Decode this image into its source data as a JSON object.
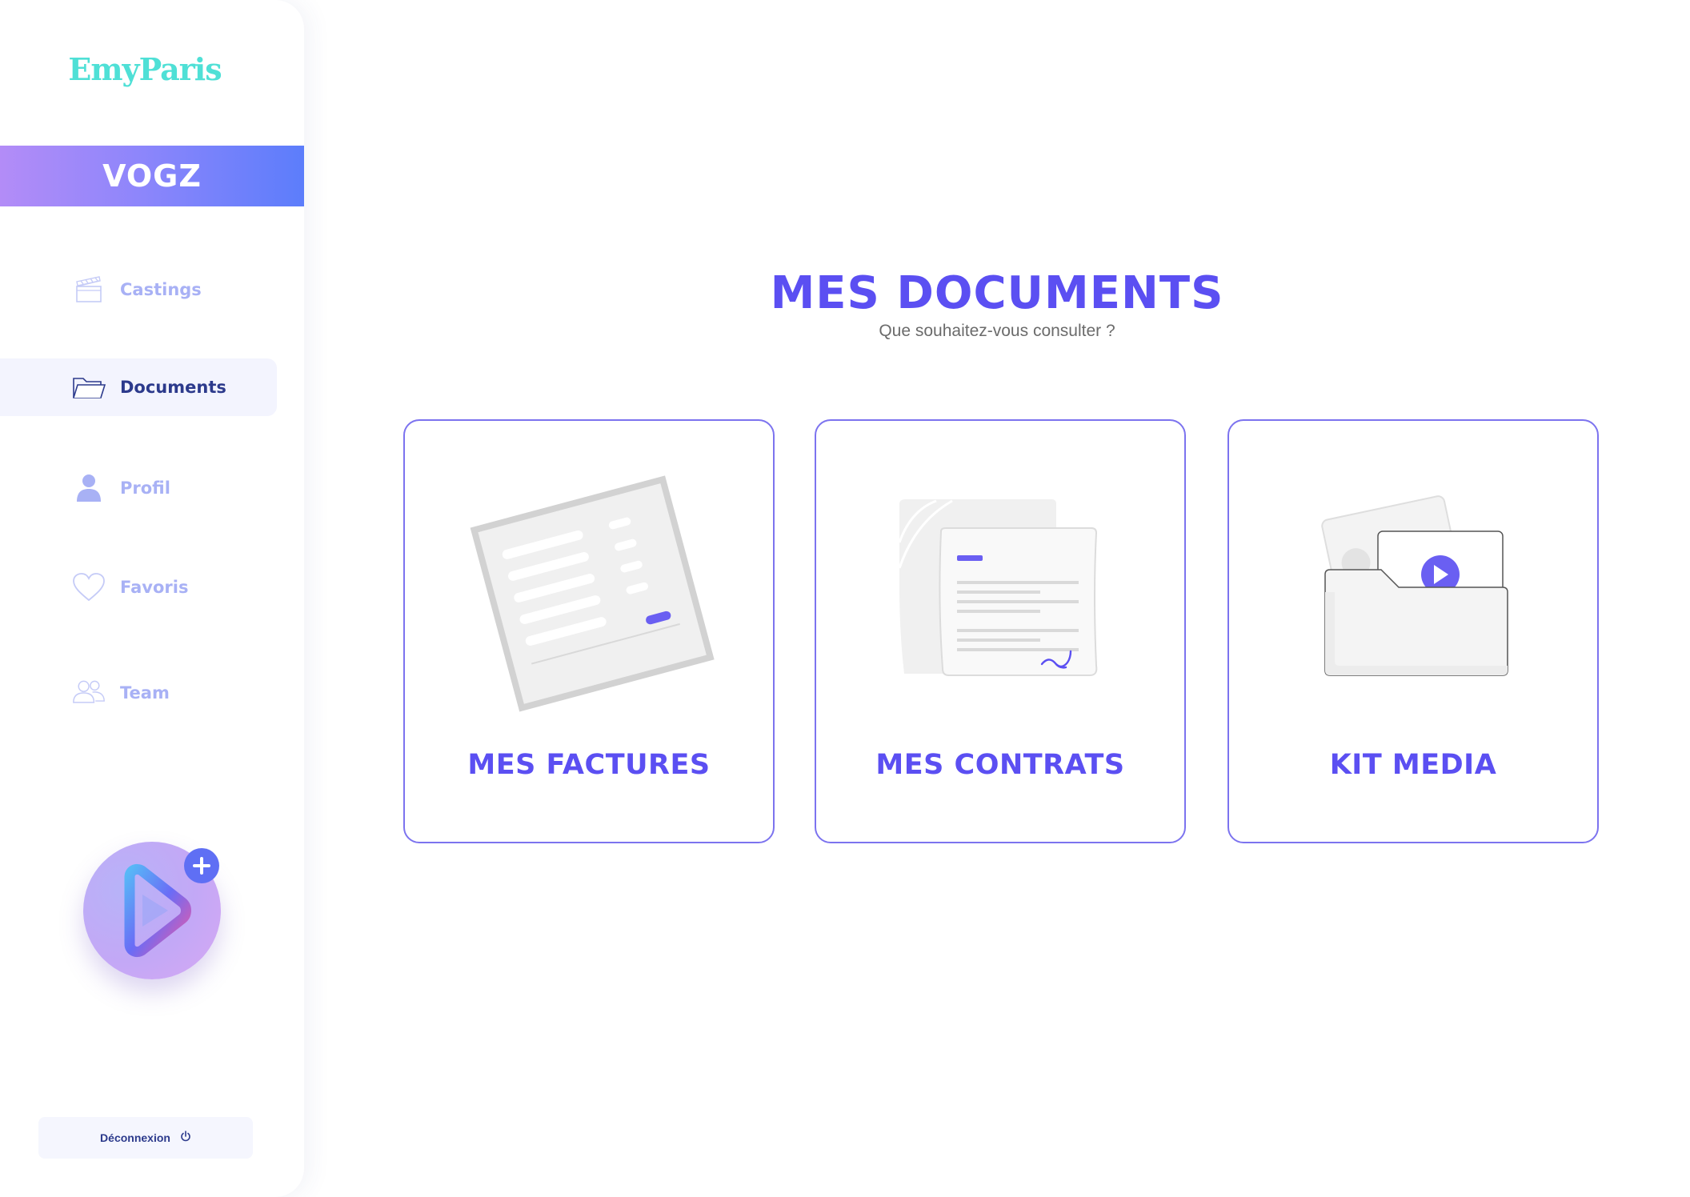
{
  "sidebar": {
    "logo": "EmyParis",
    "brand": "VOGZ",
    "items": [
      {
        "label": "Castings",
        "icon": "clapperboard-icon"
      },
      {
        "label": "Documents",
        "icon": "folder-icon",
        "active": true
      },
      {
        "label": "Profil",
        "icon": "user-icon"
      },
      {
        "label": "Favoris",
        "icon": "heart-icon"
      },
      {
        "label": "Team",
        "icon": "team-icon"
      }
    ],
    "logout_label": "Déconnexion"
  },
  "main": {
    "title": "MES DOCUMENTS",
    "subtitle": "Que souhaitez-vous consulter ?",
    "cards": [
      {
        "label": "MES FACTURES",
        "icon": "invoice-icon"
      },
      {
        "label": "MES CONTRATS",
        "icon": "contract-icon"
      },
      {
        "label": "KIT MEDIA",
        "icon": "media-folder-icon"
      }
    ]
  },
  "colors": {
    "accent": "#5b4ff2",
    "logo": "#4fe0d6",
    "nav_inactive": "#a8b1f5",
    "nav_active": "#2c3a8c"
  }
}
